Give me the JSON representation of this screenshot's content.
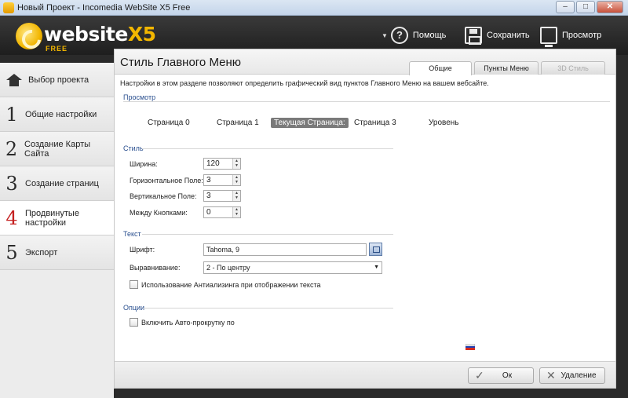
{
  "window": {
    "title": "Новый Проект - Incomedia WebSite X5 Free",
    "controls": [
      "–",
      "□",
      "✕"
    ]
  },
  "logo": {
    "word": "website",
    "x5": "X5",
    "edition": "FREE"
  },
  "header": {
    "help_label": "Помощь",
    "save_label": "Сохранить",
    "preview_label": "Просмотр"
  },
  "sidebar": {
    "items": [
      {
        "num": "",
        "label": "Выбор проекта",
        "icon": "home-icon"
      },
      {
        "num": "1",
        "label": "Общие настройки"
      },
      {
        "num": "2",
        "label": "Создание Карты Сайта"
      },
      {
        "num": "3",
        "label": "Создание страниц"
      },
      {
        "num": "4",
        "label": "Продвинутые настройки",
        "active": true
      },
      {
        "num": "5",
        "label": "Экспорт"
      }
    ]
  },
  "panel": {
    "title": "Стиль Главного Меню",
    "tabs": [
      {
        "label": "Общие",
        "active": true
      },
      {
        "label": "Пункты Меню"
      },
      {
        "label": "3D Стиль",
        "disabled": true
      }
    ],
    "description": "Настройки в этом разделе позволяют определить графический вид пунктов Главного Меню на вашем вебсайте.",
    "preview": {
      "label": "Просмотр",
      "items": [
        "Страница 0",
        "Страница 1",
        "Текущая Страница:",
        "Страница 3",
        "Уровень"
      ]
    },
    "style": {
      "label": "Стиль",
      "width_label": "Ширина:",
      "width": "120",
      "hpad_label": "Горизонтальное Поле:",
      "hpad": "3",
      "vpad_label": "Вертикальное Поле:",
      "vpad": "3",
      "spacing_label": "Между Кнопками:",
      "spacing": "0"
    },
    "text": {
      "label": "Текст",
      "font_label": "Шрифт:",
      "font": "Tahoma, 9",
      "align_label": "Выравнивание:",
      "align": "2 - По центру",
      "antialias_label": "Использование Антиализинга при отображении текста"
    },
    "options": {
      "label": "Опции",
      "autoscroll_label": "Включить Авто-прокрутку по"
    },
    "ok_label": "Ок",
    "delete_label": "Удаление"
  }
}
